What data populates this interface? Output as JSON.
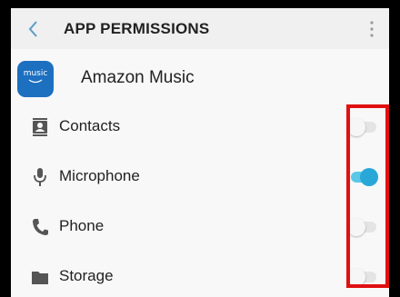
{
  "header": {
    "title": "APP PERMISSIONS",
    "back_icon": "chevron-left-icon",
    "more_icon": "more-vertical-icon"
  },
  "app": {
    "logo_text": "music",
    "name": "Amazon Music",
    "logo_color": "#1d6fc0"
  },
  "permissions": [
    {
      "label": "Contacts",
      "icon": "contacts-icon",
      "enabled": false
    },
    {
      "label": "Microphone",
      "icon": "microphone-icon",
      "enabled": true
    },
    {
      "label": "Phone",
      "icon": "phone-icon",
      "enabled": false
    },
    {
      "label": "Storage",
      "icon": "folder-icon",
      "enabled": false
    }
  ],
  "colors": {
    "accent": "#29a8d8",
    "highlight_box": "#e01010"
  }
}
